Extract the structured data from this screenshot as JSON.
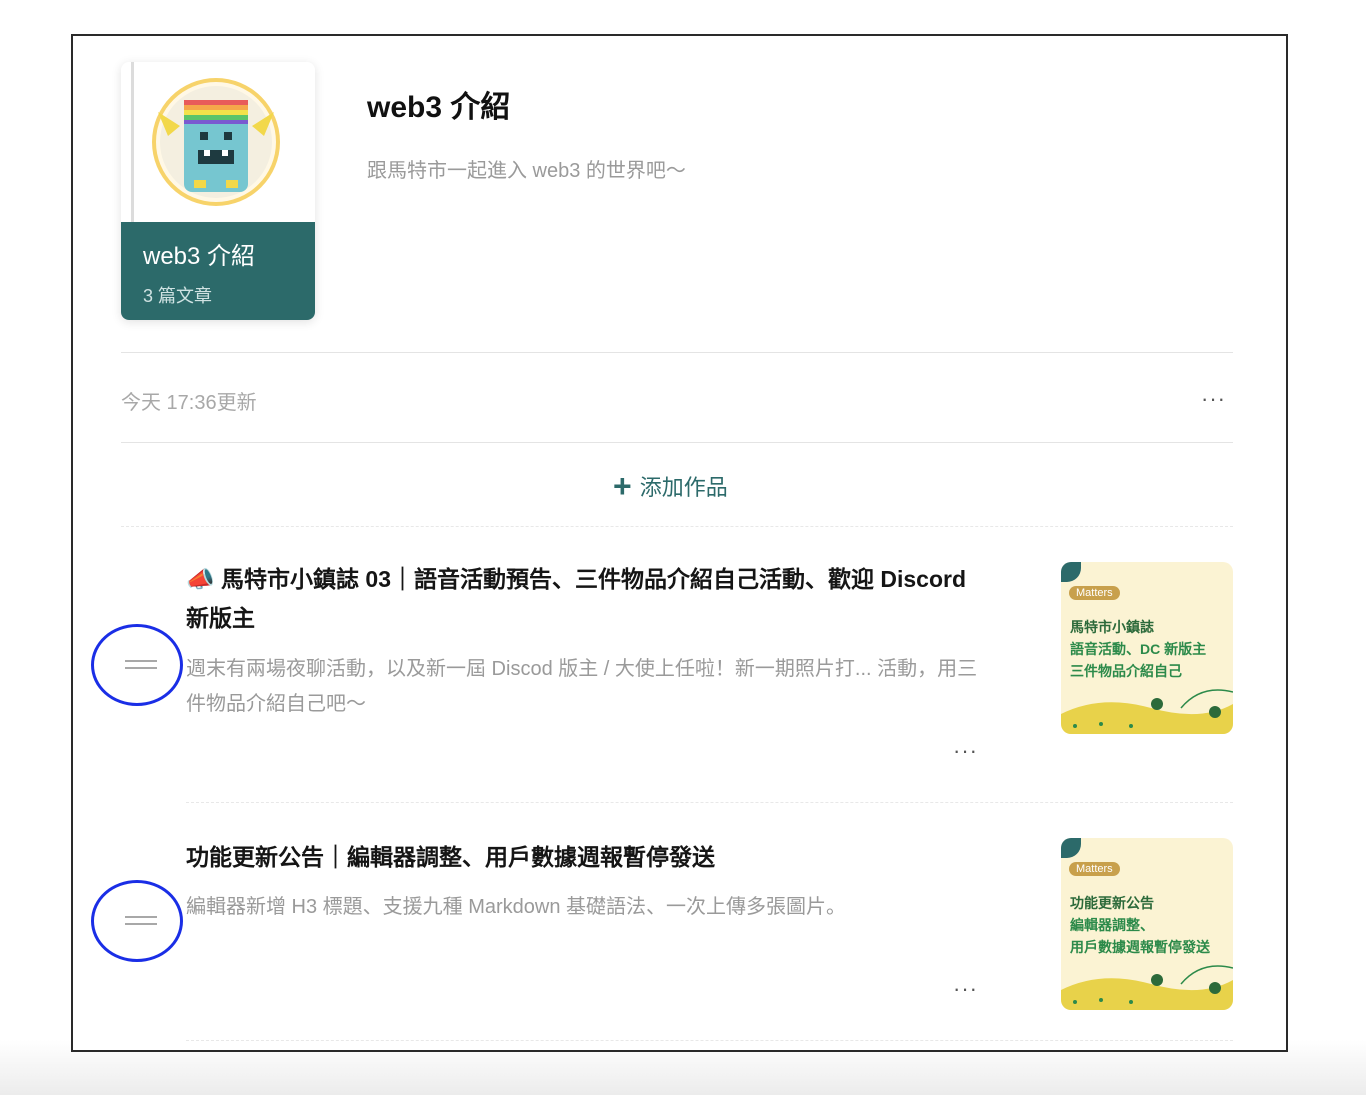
{
  "collection": {
    "cover_title": "web3 介紹",
    "cover_count": "3 篇文章",
    "title": "web3 介紹",
    "description": "跟馬特市一起進入 web3 的世界吧～",
    "updated": "今天 17:36更新",
    "more_label": "···",
    "add_label": "添加作品",
    "add_icon": "plus-icon"
  },
  "articles": [
    {
      "title": "📣 馬特市小鎮誌 03｜語音活動預告、三件物品介紹自己活動、歡迎 Discord 新版主",
      "summary": "週末有兩場夜聊活動，以及新一屆 Discod 版主 / 大使上任啦！新一期照片打... 活動，用三件物品介紹自己吧～",
      "more_label": "···",
      "thumb": {
        "badge": "Matters",
        "line1": "馬特市小鎮誌",
        "line2": "語音活動、DC 新版主",
        "line3": "三件物品介紹自己"
      }
    },
    {
      "title": "功能更新公告｜編輯器調整、用戶數據週報暫停發送",
      "summary": "編輯器新增 H3 標題、支援九種 Markdown 基礎語法、一次上傳多張圖片。",
      "more_label": "···",
      "thumb": {
        "badge": "Matters",
        "line1": "功能更新公告",
        "line2": "編輯器調整、",
        "line3": "用戶數據週報暫停發送"
      }
    }
  ],
  "colors": {
    "accent": "#2c6a6a",
    "annotation_circle": "#1a2ee6"
  }
}
